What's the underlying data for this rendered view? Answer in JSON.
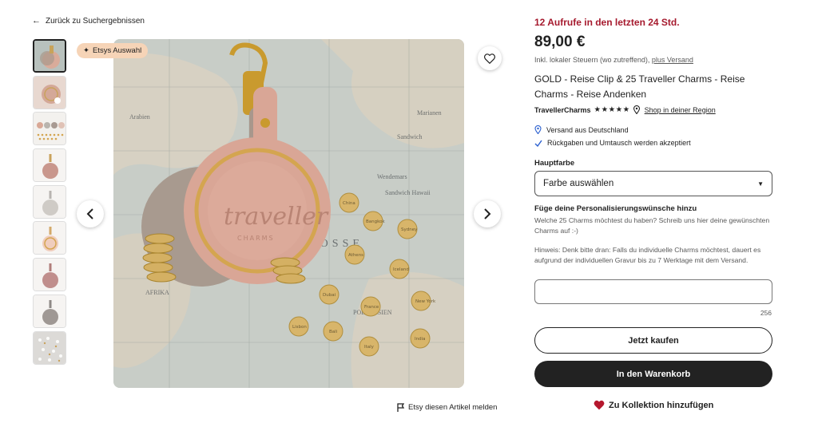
{
  "nav": {
    "back_label": "Zurück zu Suchergebnissen"
  },
  "gallery": {
    "badge_label": "Etsys Auswahl",
    "report_label": "Etsy diesen Artikel melden",
    "thumbnail_count": 9,
    "active_thumbnail": 1
  },
  "product": {
    "views": "12 Aufrufe in den letzten 24 Std.",
    "price": "89,00 €",
    "tax_prefix": "Inkl. lokaler Steuern (wo zutreffend), ",
    "tax_link": "plus Versand",
    "title": "GOLD - Reise Clip & 25 Traveller Charms - Reise Charms - Reise Andenken",
    "shop_name": "TravellerCharms",
    "stars": "★★★★★",
    "rating": 5,
    "region_link": "Shop in deiner Region",
    "shipping": "Versand aus Deutschland",
    "returns": "Rückgaben und Umtausch werden akzeptiert"
  },
  "form": {
    "color_label": "Hauptfarbe",
    "color_select": "Farbe auswählen",
    "personalization_label": "Füge deine Personalisierungswünsche hinzu",
    "personalization_text": "Welche 25 Charms möchtest du haben? Schreib uns hier deine gewünschten Charms auf :-)",
    "hint": "Hinweis: Denk bitte dran: Falls du individuelle Charms möchtest, dauert es aufgrund der individuellen Gravur bis zu 7 Werktage mit dem Versand.",
    "textarea_value": "",
    "char_counter": "256"
  },
  "actions": {
    "buy_now": "Jetzt kaufen",
    "add_to_cart": "In den Warenkorb",
    "add_to_collection": "Zu Kollektion hinzufügen"
  },
  "colors": {
    "accent_red": "#a61a2e",
    "badge_bg": "#f6d4b7",
    "button_dark": "#222222",
    "heart": "#b5182e"
  }
}
